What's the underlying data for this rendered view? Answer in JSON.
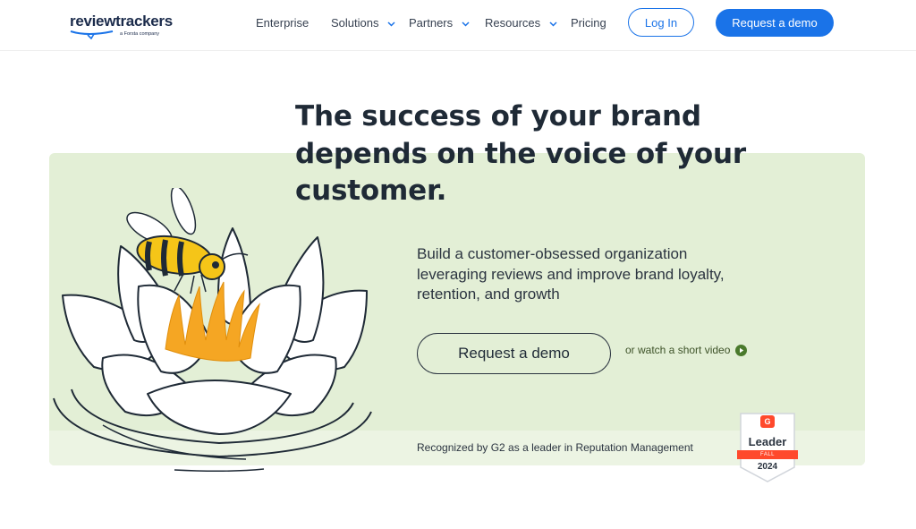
{
  "header": {
    "logo_text": "reviewtrackers",
    "logo_subtext": "a Forsta company",
    "nav": {
      "enterprise": "Enterprise",
      "solutions": "Solutions",
      "partners": "Partners",
      "resources": "Resources",
      "pricing": "Pricing"
    },
    "login_label": "Log In",
    "demo_label": "Request a demo"
  },
  "hero": {
    "headline_line1": "The success of your brand",
    "headline_line2": "depends on the voice of your",
    "headline_line3": "customer.",
    "subtext_line1": "Build a customer-obsessed organization",
    "subtext_line2": "leveraging reviews and improve brand loyalty,",
    "subtext_line3": "retention, and growth",
    "cta_label": "Request a demo",
    "video_link": "or watch a short video",
    "recognized_text": "Recognized by G2 as a leader in Reputation Management"
  },
  "badge": {
    "logo": "G",
    "title": "Leader",
    "season": "FALL",
    "year": "2024"
  },
  "colors": {
    "brand_blue": "#1a73e8",
    "hero_green": "#e3efd6",
    "text_dark": "#1f2a36",
    "g2_red": "#ff492c"
  }
}
